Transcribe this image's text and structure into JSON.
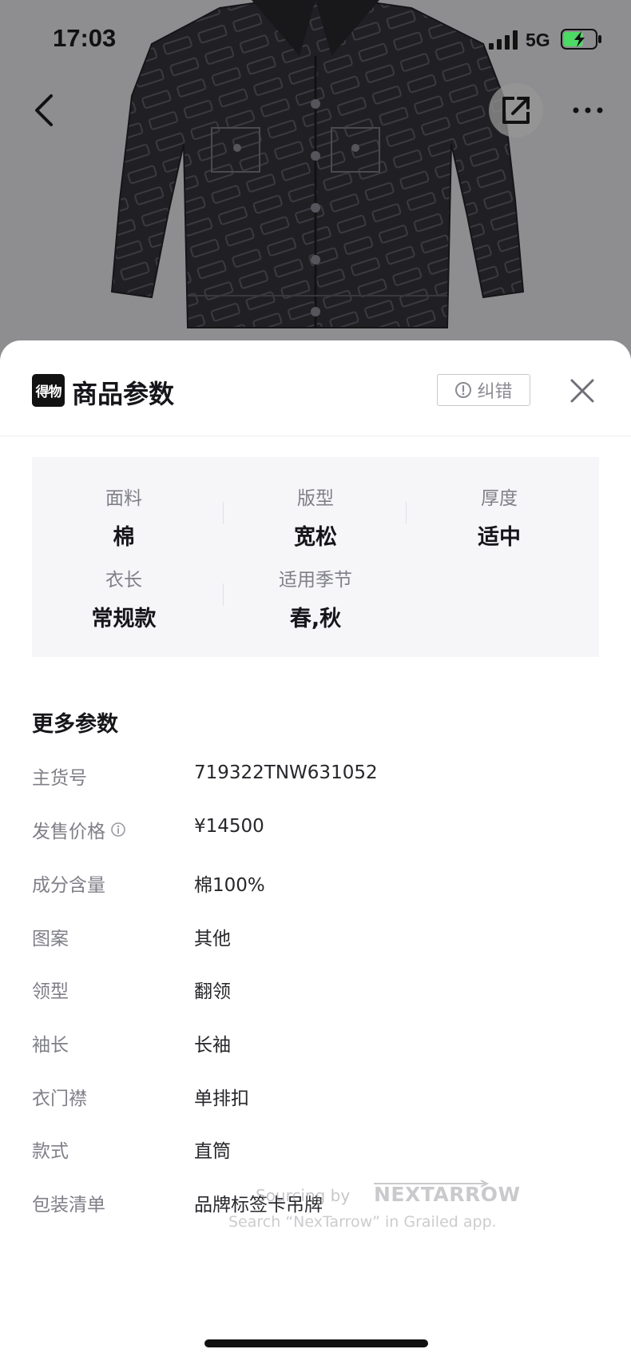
{
  "status_bar": {
    "time": "17:03",
    "network": "5G",
    "battery_charging": true
  },
  "nav": {
    "back_icon": "chevron-left-icon",
    "share_icon": "external-share-icon",
    "more_icon": "more-dots-icon"
  },
  "sheet": {
    "logo_text": "得物",
    "title": "商品参数",
    "report_button": "纠错",
    "close_icon": "close-icon"
  },
  "key_params": [
    {
      "label": "面料",
      "value": "棉"
    },
    {
      "label": "版型",
      "value": "宽松"
    },
    {
      "label": "厚度",
      "value": "适中"
    },
    {
      "label": "衣长",
      "value": "常规款"
    },
    {
      "label": "适用季节",
      "value": "春,秋"
    }
  ],
  "more_params": {
    "title": "更多参数",
    "rows": [
      {
        "label": "主货号",
        "value": "719322TNW631052"
      },
      {
        "label": "发售价格",
        "value": "¥14500",
        "has_info": true
      },
      {
        "label": "成分含量",
        "value": "棉100%"
      },
      {
        "label": "图案",
        "value": "其他"
      },
      {
        "label": "领型",
        "value": "翻领"
      },
      {
        "label": "袖长",
        "value": "长袖"
      },
      {
        "label": "衣门襟",
        "value": "单排扣"
      },
      {
        "label": "款式",
        "value": "直筒"
      },
      {
        "label": "包装清单",
        "value": "品牌标签卡吊牌"
      }
    ]
  },
  "watermark": {
    "line1": "Sourcing by",
    "brand": "NEXTARROW",
    "line2": "Search “NexTarrow” in Grailed app."
  },
  "colors": {
    "backdrop": "#8e8e90",
    "jacket": "#1f1f22",
    "label_gray": "#7f7f88",
    "panel_bg": "#f6f6f9"
  }
}
